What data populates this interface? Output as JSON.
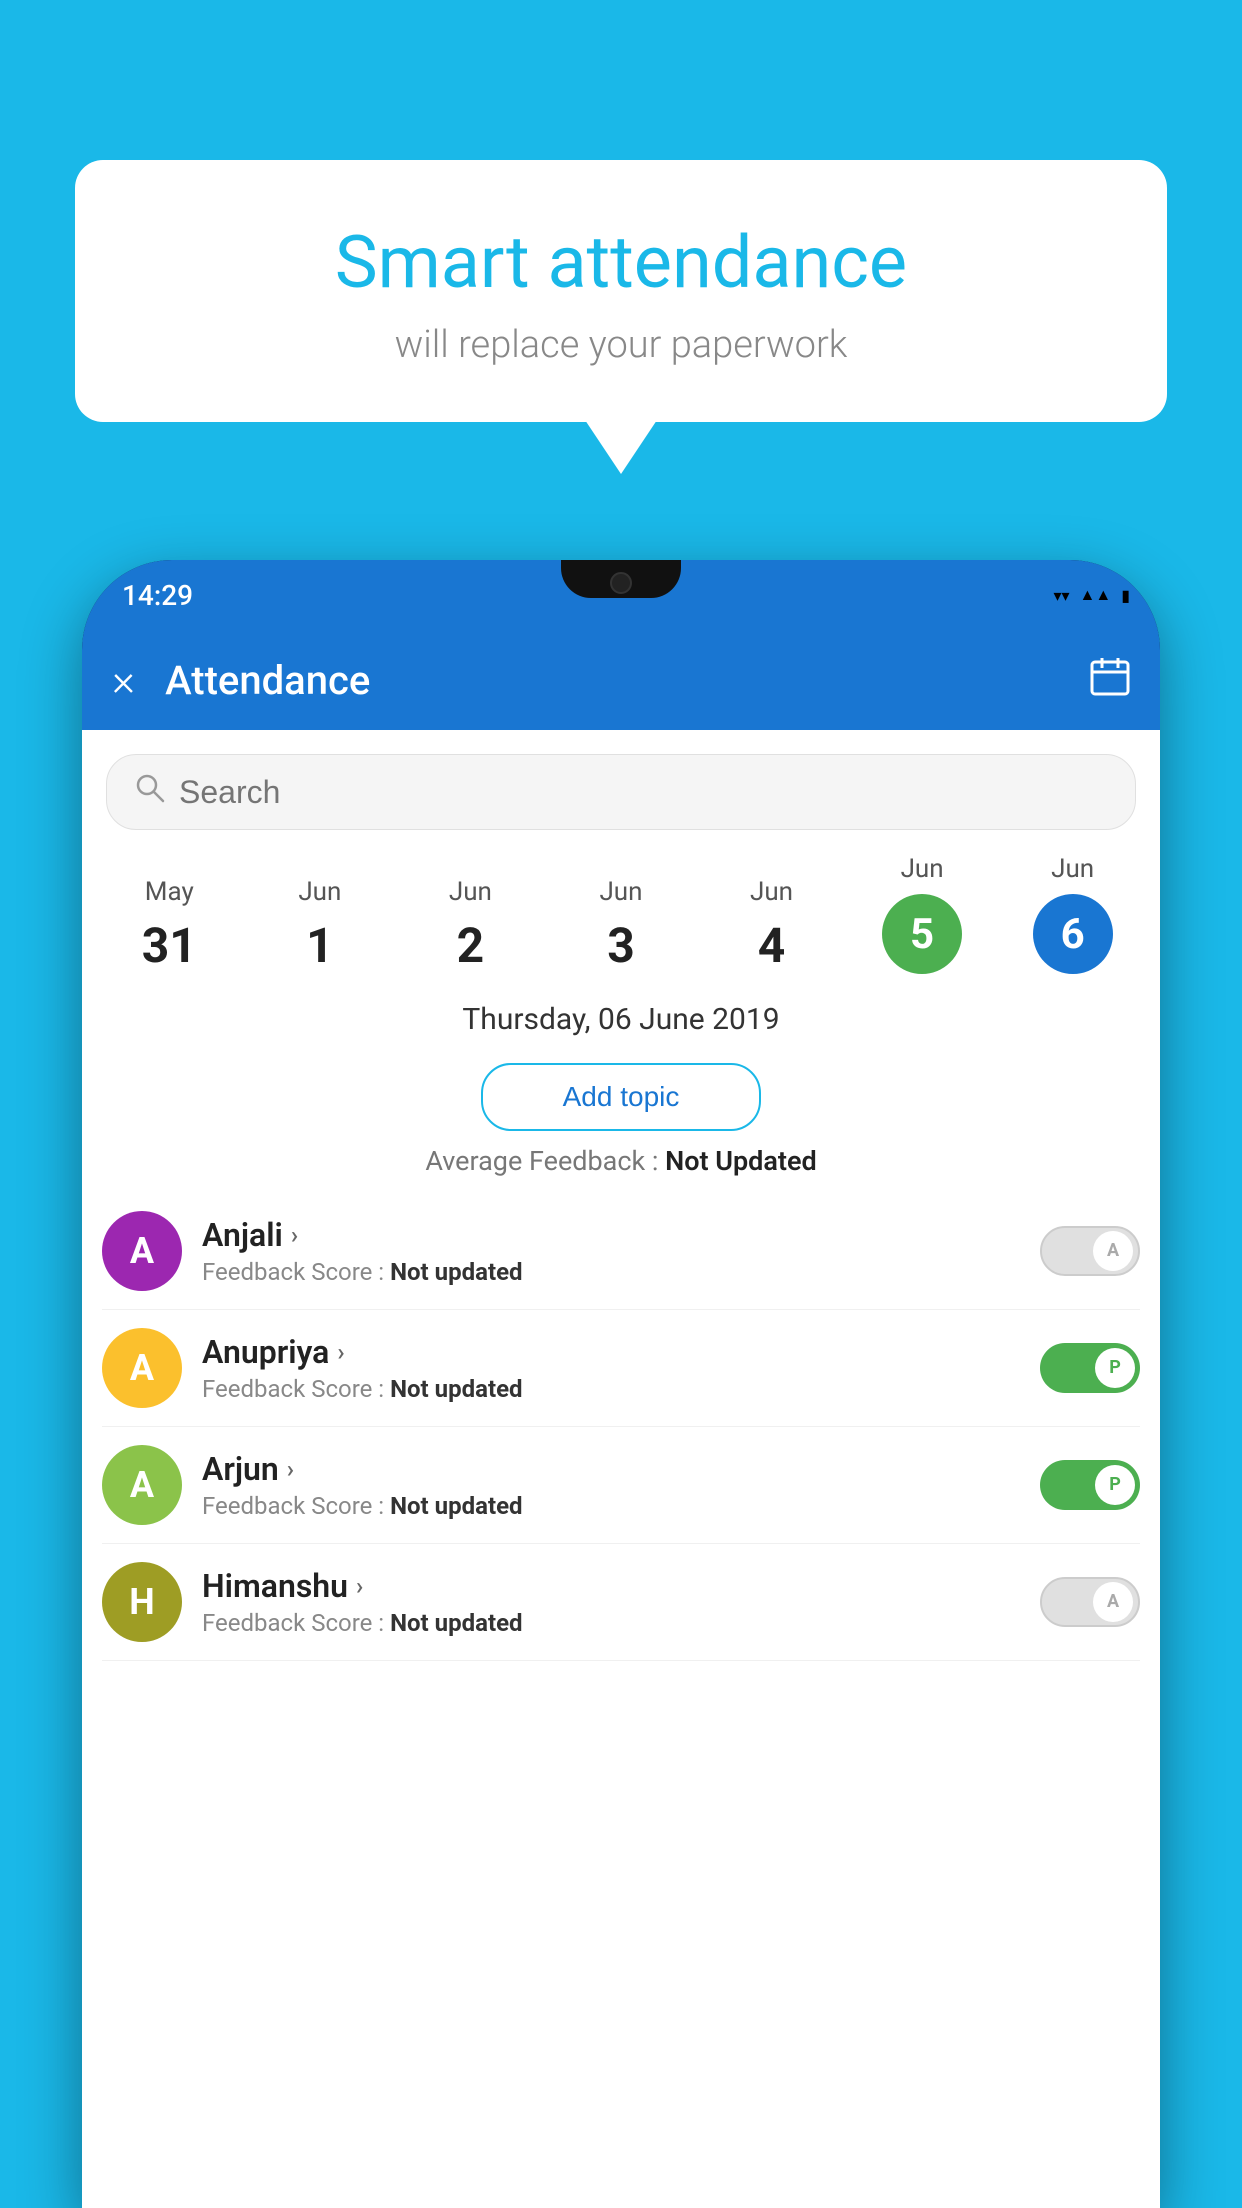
{
  "background_color": "#1ab8e8",
  "bubble": {
    "title": "Smart attendance",
    "subtitle": "will replace your paperwork"
  },
  "status_bar": {
    "time": "14:29",
    "wifi": "▼",
    "signal": "▲",
    "battery": "▮"
  },
  "header": {
    "title": "Attendance",
    "close_label": "×",
    "calendar_label": "📅"
  },
  "search": {
    "placeholder": "Search"
  },
  "dates": [
    {
      "month": "May",
      "day": "31",
      "type": "normal"
    },
    {
      "month": "Jun",
      "day": "1",
      "type": "normal"
    },
    {
      "month": "Jun",
      "day": "2",
      "type": "normal"
    },
    {
      "month": "Jun",
      "day": "3",
      "type": "normal"
    },
    {
      "month": "Jun",
      "day": "4",
      "type": "normal"
    },
    {
      "month": "Jun",
      "day": "5",
      "type": "green"
    },
    {
      "month": "Jun",
      "day": "6",
      "type": "blue"
    }
  ],
  "selected_date": "Thursday, 06 June 2019",
  "add_topic_label": "Add topic",
  "avg_feedback_label": "Average Feedback :",
  "avg_feedback_value": "Not Updated",
  "students": [
    {
      "name": "Anjali",
      "avatar_letter": "A",
      "avatar_color": "purple",
      "feedback_label": "Feedback Score :",
      "feedback_value": "Not updated",
      "toggle": "off"
    },
    {
      "name": "Anupriya",
      "avatar_letter": "A",
      "avatar_color": "yellow",
      "feedback_label": "Feedback Score :",
      "feedback_value": "Not updated",
      "toggle": "on"
    },
    {
      "name": "Arjun",
      "avatar_letter": "A",
      "avatar_color": "green",
      "feedback_label": "Feedback Score :",
      "feedback_value": "Not updated",
      "toggle": "on"
    },
    {
      "name": "Himanshu",
      "avatar_letter": "H",
      "avatar_color": "olive",
      "feedback_label": "Feedback Score :",
      "feedback_value": "Not updated",
      "toggle": "off"
    }
  ]
}
